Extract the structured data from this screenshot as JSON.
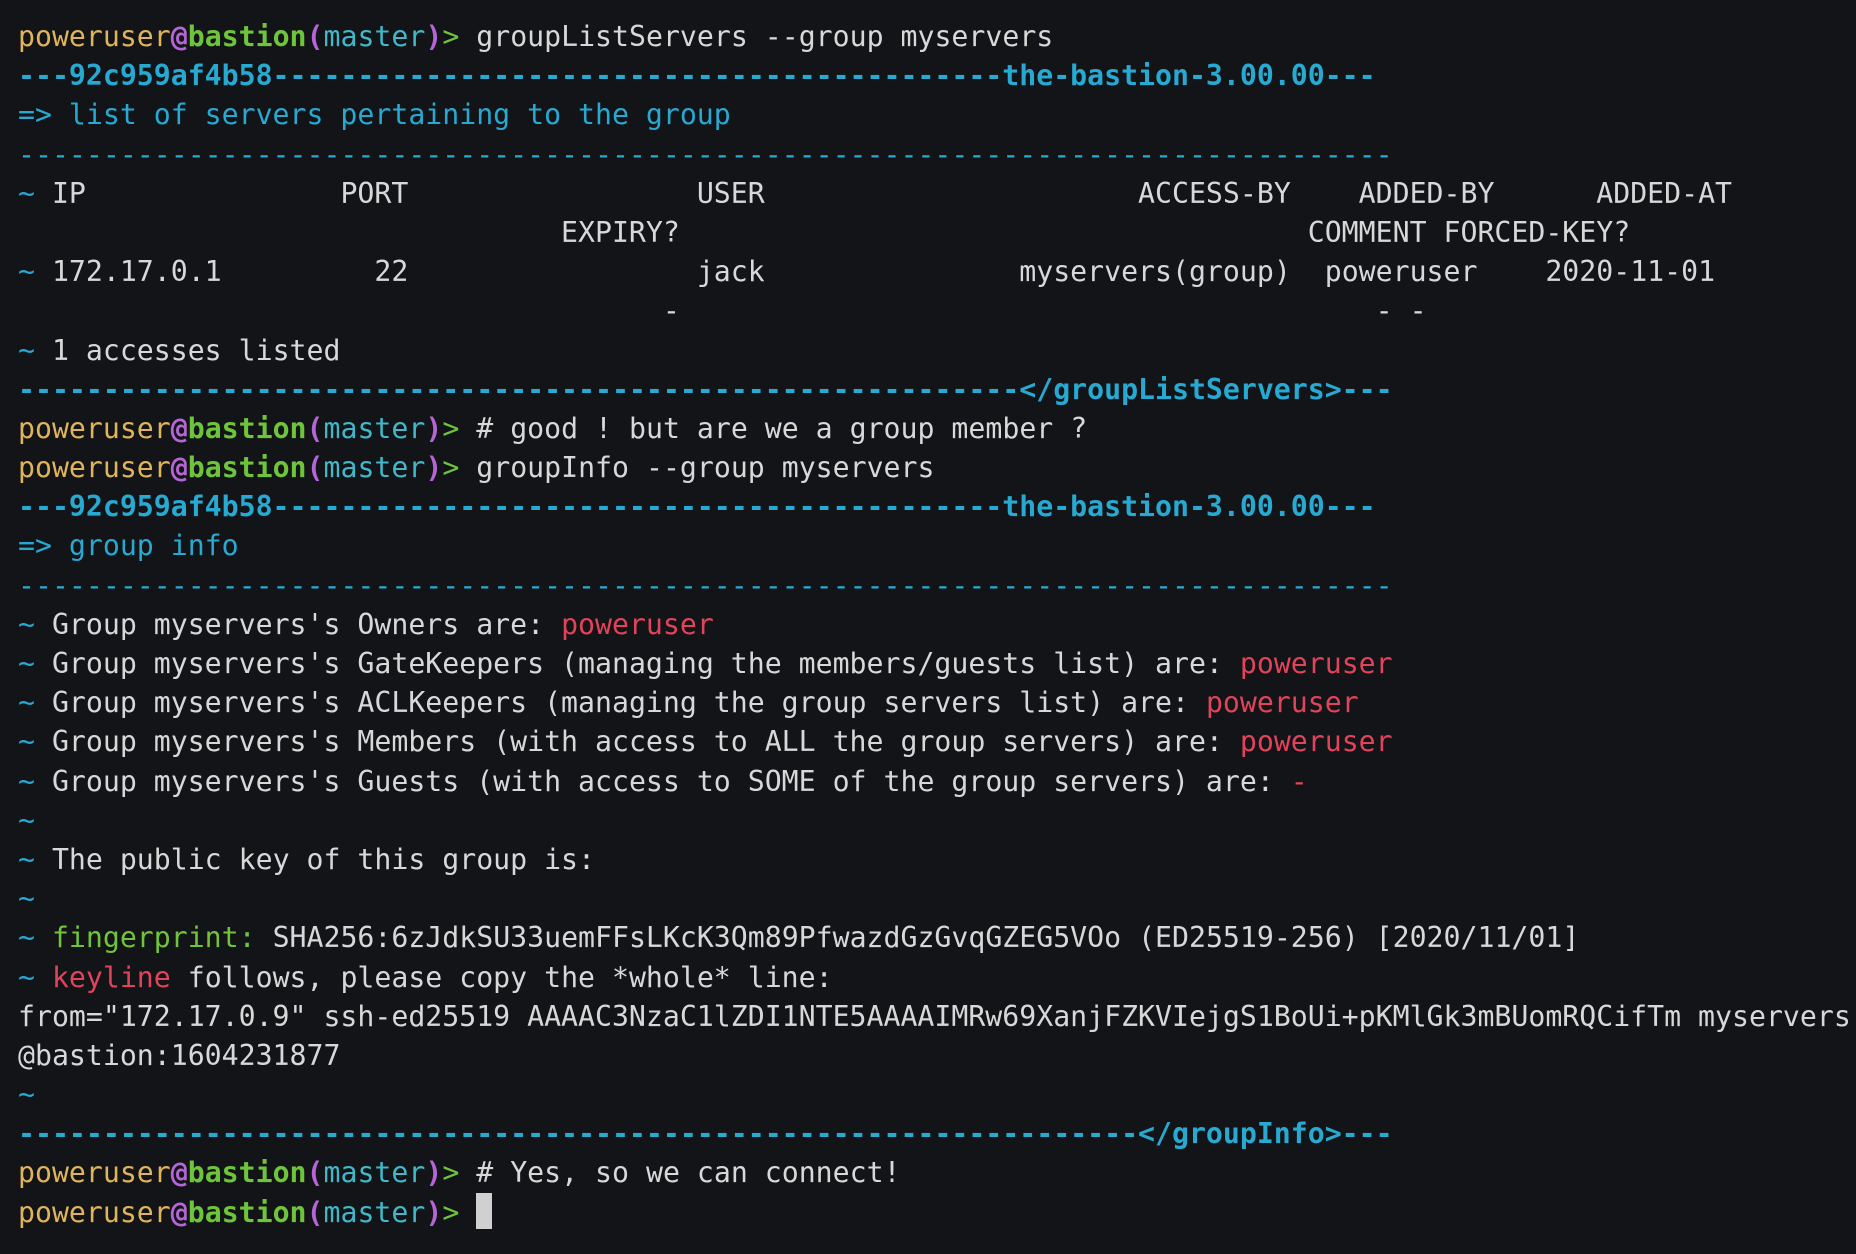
{
  "colors": {
    "background": "#121417",
    "text": "#d8d8d8",
    "user": "#e0b45a",
    "at": "#b565d6",
    "host": "#6ec53c",
    "branch": "#41b7c8",
    "cyan": "#27a9d2",
    "red": "#e0435a",
    "green": "#72c33a"
  },
  "terminal": {
    "lines": [
      {
        "segments": [
          {
            "text": "poweruser",
            "color": "#e0b45a"
          },
          {
            "text": "@",
            "color": "#b565d6",
            "bold": true
          },
          {
            "text": "bastion",
            "color": "#6ec53c",
            "bold": true
          },
          {
            "text": "(",
            "color": "#b565d6",
            "bold": true
          },
          {
            "text": "master",
            "color": "#41b7c8"
          },
          {
            "text": ")",
            "color": "#b565d6",
            "bold": true
          },
          {
            "text": "> ",
            "color": "#6ec53c"
          },
          {
            "text": "groupListServers --group myservers",
            "color": "#d8d8d8"
          }
        ]
      },
      {
        "segments": [
          {
            "text": "---92c959af4b58-------------------------------------------the-bastion-3.00.00---",
            "color": "#27a9d2",
            "bold": true
          }
        ]
      },
      {
        "segments": [
          {
            "text": "=> list of servers pertaining to the group",
            "color": "#27a9d2"
          }
        ]
      },
      {
        "segments": [
          {
            "text": "---------------------------------------------------------------------------------",
            "color": "#27a9d2"
          }
        ]
      },
      {
        "segments": [
          {
            "text": "~ ",
            "color": "#27a9d2"
          },
          {
            "text": "IP               PORT                 USER                      ACCESS-BY    ADDED-BY      ADDED-AT",
            "color": "#d8d8d8"
          }
        ]
      },
      {
        "segments": [
          {
            "text": "                                EXPIRY?                                     COMMENT FORCED-KEY?",
            "color": "#d8d8d8"
          }
        ]
      },
      {
        "segments": [
          {
            "text": "~ ",
            "color": "#27a9d2"
          },
          {
            "text": "172.17.0.1         22                 jack               myservers(group)  poweruser    2020-11-01",
            "color": "#d8d8d8"
          }
        ]
      },
      {
        "segments": [
          {
            "text": "                                      -                                         - -",
            "color": "#d8d8d8"
          }
        ]
      },
      {
        "segments": [
          {
            "text": "~ ",
            "color": "#27a9d2"
          },
          {
            "text": "1 accesses listed",
            "color": "#d8d8d8"
          }
        ]
      },
      {
        "segments": [
          {
            "text": "-----------------------------------------------------------</groupListServers>---",
            "color": "#27a9d2",
            "bold": true
          }
        ]
      },
      {
        "segments": [
          {
            "text": "poweruser",
            "color": "#e0b45a"
          },
          {
            "text": "@",
            "color": "#b565d6",
            "bold": true
          },
          {
            "text": "bastion",
            "color": "#6ec53c",
            "bold": true
          },
          {
            "text": "(",
            "color": "#b565d6",
            "bold": true
          },
          {
            "text": "master",
            "color": "#41b7c8"
          },
          {
            "text": ")",
            "color": "#b565d6",
            "bold": true
          },
          {
            "text": "> ",
            "color": "#6ec53c"
          },
          {
            "text": "# good ! but are we a group member ?",
            "color": "#d8d8d8"
          }
        ]
      },
      {
        "segments": [
          {
            "text": "poweruser",
            "color": "#e0b45a"
          },
          {
            "text": "@",
            "color": "#b565d6",
            "bold": true
          },
          {
            "text": "bastion",
            "color": "#6ec53c",
            "bold": true
          },
          {
            "text": "(",
            "color": "#b565d6",
            "bold": true
          },
          {
            "text": "master",
            "color": "#41b7c8"
          },
          {
            "text": ")",
            "color": "#b565d6",
            "bold": true
          },
          {
            "text": "> ",
            "color": "#6ec53c"
          },
          {
            "text": "groupInfo --group myservers",
            "color": "#d8d8d8"
          }
        ]
      },
      {
        "segments": [
          {
            "text": "---92c959af4b58-------------------------------------------the-bastion-3.00.00---",
            "color": "#27a9d2",
            "bold": true
          }
        ]
      },
      {
        "segments": [
          {
            "text": "=> group info",
            "color": "#27a9d2"
          }
        ]
      },
      {
        "segments": [
          {
            "text": "---------------------------------------------------------------------------------",
            "color": "#27a9d2"
          }
        ]
      },
      {
        "segments": [
          {
            "text": "~ ",
            "color": "#27a9d2"
          },
          {
            "text": "Group myservers's Owners are: ",
            "color": "#d8d8d8"
          },
          {
            "text": "poweruser",
            "color": "#e0435a"
          }
        ]
      },
      {
        "segments": [
          {
            "text": "~ ",
            "color": "#27a9d2"
          },
          {
            "text": "Group myservers's GateKeepers (managing the members/guests list) are: ",
            "color": "#d8d8d8"
          },
          {
            "text": "poweruser",
            "color": "#e0435a"
          }
        ]
      },
      {
        "segments": [
          {
            "text": "~ ",
            "color": "#27a9d2"
          },
          {
            "text": "Group myservers's ACLKeepers (managing the group servers list) are: ",
            "color": "#d8d8d8"
          },
          {
            "text": "poweruser",
            "color": "#e0435a"
          }
        ]
      },
      {
        "segments": [
          {
            "text": "~ ",
            "color": "#27a9d2"
          },
          {
            "text": "Group myservers's Members (with access to ALL the group servers) are: ",
            "color": "#d8d8d8"
          },
          {
            "text": "poweruser",
            "color": "#e0435a"
          }
        ]
      },
      {
        "segments": [
          {
            "text": "~ ",
            "color": "#27a9d2"
          },
          {
            "text": "Group myservers's Guests (with access to SOME of the group servers) are: ",
            "color": "#d8d8d8"
          },
          {
            "text": "-",
            "color": "#e0435a"
          }
        ]
      },
      {
        "segments": [
          {
            "text": "~",
            "color": "#27a9d2"
          }
        ]
      },
      {
        "segments": [
          {
            "text": "~ ",
            "color": "#27a9d2"
          },
          {
            "text": "The public key of this group is:",
            "color": "#d8d8d8"
          }
        ]
      },
      {
        "segments": [
          {
            "text": "~",
            "color": "#27a9d2"
          }
        ]
      },
      {
        "segments": [
          {
            "text": "~ ",
            "color": "#27a9d2"
          },
          {
            "text": "fingerprint:",
            "color": "#72c33a"
          },
          {
            "text": " SHA256:6zJdkSU33uemFFsLKcK3Qm89PfwazdGzGvqGZEG5VOo (ED25519-256) [2020/11/01]",
            "color": "#d8d8d8"
          }
        ]
      },
      {
        "segments": [
          {
            "text": "~ ",
            "color": "#27a9d2"
          },
          {
            "text": "keyline",
            "color": "#e0435a"
          },
          {
            "text": " follows, please copy the *whole* line:",
            "color": "#d8d8d8"
          }
        ]
      },
      {
        "segments": [
          {
            "text": "from=\"172.17.0.9\" ssh-ed25519 AAAAC3NzaC1lZDI1NTE5AAAAIMRw69XanjFZKVIejgS1BoUi+pKMlGk3mBUomRQCifTm myservers",
            "color": "#d8d8d8"
          }
        ]
      },
      {
        "segments": [
          {
            "text": "@bastion:1604231877",
            "color": "#d8d8d8"
          }
        ]
      },
      {
        "segments": [
          {
            "text": "~",
            "color": "#27a9d2"
          }
        ]
      },
      {
        "segments": [
          {
            "text": "------------------------------------------------------------------</groupInfo>---",
            "color": "#27a9d2",
            "bold": true
          }
        ]
      },
      {
        "segments": [
          {
            "text": "poweruser",
            "color": "#e0b45a"
          },
          {
            "text": "@",
            "color": "#b565d6",
            "bold": true
          },
          {
            "text": "bastion",
            "color": "#6ec53c",
            "bold": true
          },
          {
            "text": "(",
            "color": "#b565d6",
            "bold": true
          },
          {
            "text": "master",
            "color": "#41b7c8"
          },
          {
            "text": ")",
            "color": "#b565d6",
            "bold": true
          },
          {
            "text": "> ",
            "color": "#6ec53c"
          },
          {
            "text": "# Yes, so we can connect!",
            "color": "#d8d8d8"
          }
        ]
      },
      {
        "segments": [
          {
            "text": "poweruser",
            "color": "#e0b45a"
          },
          {
            "text": "@",
            "color": "#b565d6",
            "bold": true
          },
          {
            "text": "bastion",
            "color": "#6ec53c",
            "bold": true
          },
          {
            "text": "(",
            "color": "#b565d6",
            "bold": true
          },
          {
            "text": "master",
            "color": "#41b7c8"
          },
          {
            "text": ")",
            "color": "#b565d6",
            "bold": true
          },
          {
            "text": "> ",
            "color": "#6ec53c"
          }
        ],
        "cursor": true
      }
    ]
  }
}
